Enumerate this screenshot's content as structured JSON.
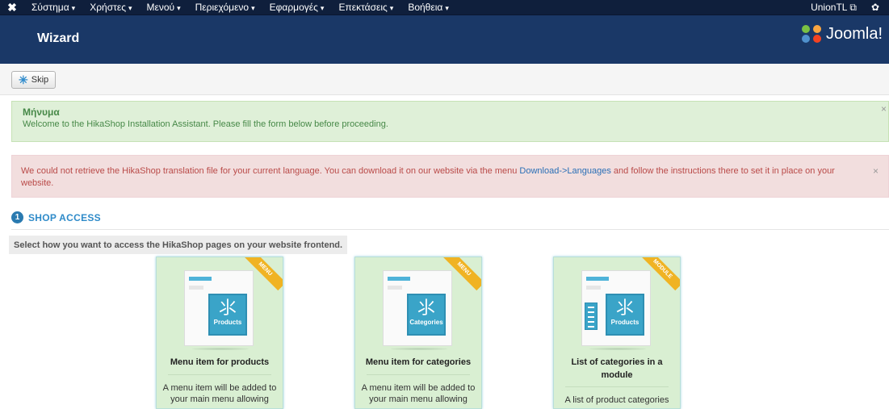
{
  "topbar": {
    "logo": "✖",
    "menus": [
      "Σύστημα",
      "Χρήστες",
      "Μενού",
      "Περιεχόμενο",
      "Εφαρμογές",
      "Επεκτάσεις",
      "Βοήθεια"
    ],
    "caret": "▾",
    "user": "UnionTL",
    "external_icon": "⧉",
    "gear": "✿"
  },
  "titlebar": {
    "title": "Wizard",
    "brand": "Joomla!"
  },
  "toolbar": {
    "skip_label": "Skip",
    "skip_icon": "✳"
  },
  "alert_success": {
    "heading": "Μήνυμα",
    "text": "Welcome to the HikaShop Installation Assistant. Please fill the form below before proceeding.",
    "close": "×"
  },
  "alert_error": {
    "text_before": "We could not retrieve the HikaShop translation file for your current language. You can download it on our website via the menu ",
    "link": "Download->Languages",
    "text_after": " and follow the instructions there to set it in place on your website.",
    "close": "×"
  },
  "section": {
    "number": "1",
    "label": "SHOP ACCESS"
  },
  "instruction": "Select how you want to access the HikaShop pages on your website frontend.",
  "cards": [
    {
      "ribbon": "MENU",
      "tile_label": "Products",
      "title": "Menu item for products",
      "desc": "A menu item will be added to your main menu allowing"
    },
    {
      "ribbon": "MENU",
      "tile_label": "Categories",
      "title": "Menu item for categories",
      "desc": "A menu item will be added to your main menu allowing"
    },
    {
      "ribbon": "MODULE",
      "tile_label": "Products",
      "title": "List of categories in a module",
      "desc": "A list of product categories"
    }
  ],
  "colors": {
    "topbar": "#0f1f3c",
    "titlebar": "#1a3867",
    "accent": "#2f8bc9",
    "card_bg": "#d9efd2"
  }
}
